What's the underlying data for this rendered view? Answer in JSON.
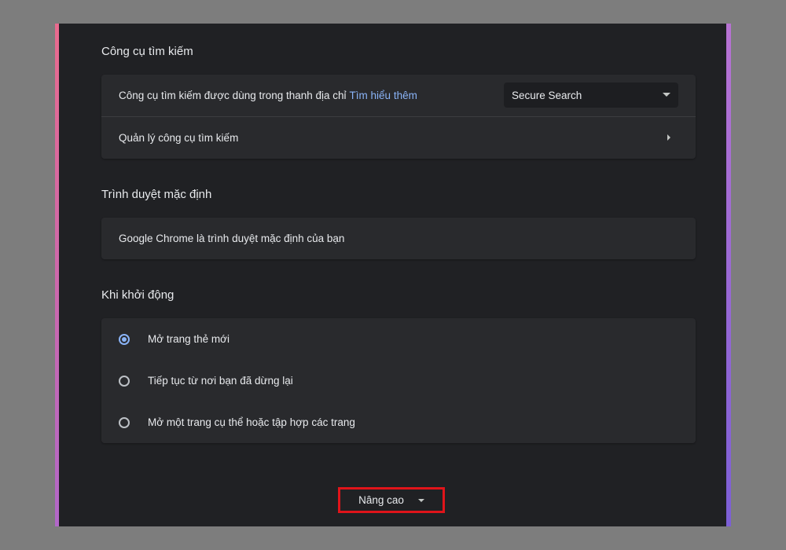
{
  "search_engine": {
    "title": "Công cụ tìm kiếm",
    "description": "Công cụ tìm kiếm được dùng trong thanh địa chỉ",
    "learn_more_link": "Tìm hiểu thêm",
    "selected_engine": "Secure Search",
    "manage_label": "Quản lý công cụ tìm kiếm"
  },
  "default_browser": {
    "title": "Trình duyệt mặc định",
    "status": "Google Chrome là trình duyệt mặc định của bạn"
  },
  "startup": {
    "title": "Khi khởi động",
    "options": [
      {
        "label": "Mở trang thẻ mới",
        "checked": true
      },
      {
        "label": "Tiếp tục từ nơi bạn đã dừng lại",
        "checked": false
      },
      {
        "label": "Mở một trang cụ thể hoặc tập hợp các trang",
        "checked": false
      }
    ]
  },
  "advanced": {
    "label": "Nâng cao"
  },
  "colors": {
    "background": "#202124",
    "card": "#292a2d",
    "accent": "#8ab4f8",
    "highlight_box": "#e0141a"
  }
}
